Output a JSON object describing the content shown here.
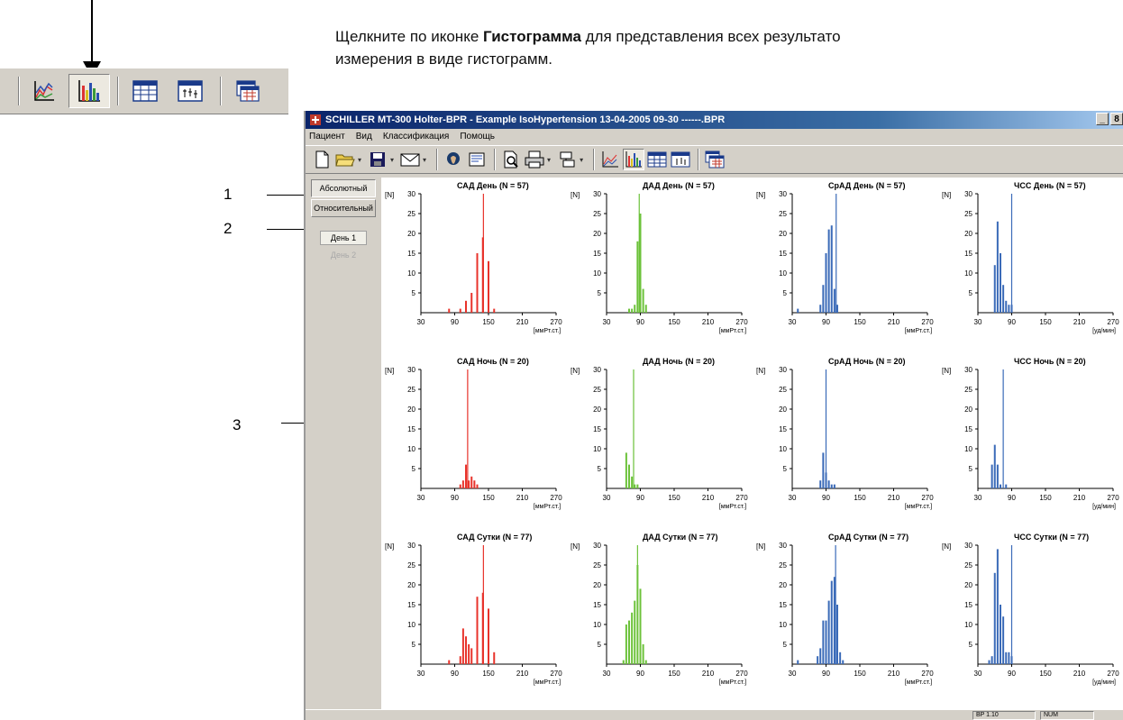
{
  "instruction": {
    "before": "Щелкните по иконке ",
    "bold": "Гистограмма",
    "after": " для представления всех результато",
    "line2": "измерения в виде гистограмм."
  },
  "callouts": [
    "1",
    "2",
    "3"
  ],
  "window": {
    "title": "SCHILLER MT-300 Holter-BPR - Example IsoHypertension 13-04-2005 09-30 ------.BPR",
    "controls": [
      "_",
      "8"
    ]
  },
  "menu": [
    "Пациент",
    "Вид",
    "Классификация",
    "Помощь"
  ],
  "toolbar_icons": [
    "new-file-icon",
    "open-folder-icon",
    "save-icon",
    "mail-icon",
    "patient-icon",
    "report-icon",
    "print-preview-icon",
    "print-icon",
    "device-icon",
    "trend-chart-icon",
    "histogram-icon",
    "table-icon",
    "statistics-table-icon",
    "window-icon"
  ],
  "side_panel": {
    "absolute": "Абсолютный",
    "relative": "Относительный",
    "day1": "День 1",
    "day2": "День 2"
  },
  "status": [
    "BP 1.10",
    "NUM"
  ],
  "colors": {
    "sad": "#e8332b",
    "dad": "#6cc23a",
    "srad": "#3a6ab8",
    "hr": "#3a6ab8"
  },
  "chart_data": [
    {
      "type": "bar",
      "title": "САД День (N = 57)",
      "ylabel": "[N]",
      "xlabel": "[ммРт.ст.]",
      "x_ticks": [
        30,
        90,
        150,
        210,
        270
      ],
      "ylim": [
        0,
        30
      ],
      "y_ticks": [
        5,
        10,
        15,
        20,
        25,
        30
      ],
      "color": "#e8332b",
      "marker": 141,
      "x": [
        80,
        100,
        110,
        120,
        130,
        140,
        150,
        160
      ],
      "values": [
        1,
        1,
        3,
        5,
        15,
        19,
        13,
        1
      ]
    },
    {
      "type": "bar",
      "title": "ДАД День (N = 57)",
      "ylabel": "[N]",
      "xlabel": "[ммРт.ст.]",
      "x_ticks": [
        30,
        90,
        150,
        210,
        270
      ],
      "ylim": [
        0,
        30
      ],
      "y_ticks": [
        5,
        10,
        15,
        20,
        25,
        30
      ],
      "color": "#6cc23a",
      "marker": 88,
      "x": [
        70,
        75,
        80,
        85,
        90,
        95,
        100
      ],
      "values": [
        1,
        1,
        2,
        18,
        25,
        6,
        2
      ]
    },
    {
      "type": "bar",
      "title": "СрАД День (N = 57)",
      "ylabel": "[N]",
      "xlabel": "[ммРт.ст.]",
      "x_ticks": [
        30,
        90,
        150,
        210,
        270
      ],
      "ylim": [
        0,
        30
      ],
      "y_ticks": [
        5,
        10,
        15,
        20,
        25,
        30
      ],
      "color": "#3a6ab8",
      "marker": 108,
      "x": [
        40,
        80,
        85,
        90,
        95,
        100,
        105,
        110
      ],
      "values": [
        1,
        2,
        7,
        15,
        21,
        22,
        6,
        2
      ]
    },
    {
      "type": "bar",
      "title": "ЧСС День (N = 57)",
      "ylabel": "[N]",
      "xlabel": "[уд/мин]",
      "x_ticks": [
        30,
        90,
        150,
        210,
        270
      ],
      "ylim": [
        0,
        30
      ],
      "y_ticks": [
        5,
        10,
        15,
        20,
        25,
        30
      ],
      "color": "#3a6ab8",
      "marker": 90,
      "x": [
        60,
        65,
        70,
        75,
        80,
        85,
        90
      ],
      "values": [
        12,
        23,
        15,
        7,
        3,
        2,
        2
      ]
    },
    {
      "type": "bar",
      "title": "САД Ночь (N = 20)",
      "ylabel": "[N]",
      "xlabel": "[ммРт.ст.]",
      "x_ticks": [
        30,
        90,
        150,
        210,
        270
      ],
      "ylim": [
        0,
        30
      ],
      "y_ticks": [
        5,
        10,
        15,
        20,
        25,
        30
      ],
      "color": "#e8332b",
      "marker": 113,
      "x": [
        100,
        105,
        110,
        115,
        120,
        125,
        130
      ],
      "values": [
        1,
        2,
        6,
        2,
        3,
        2,
        1
      ]
    },
    {
      "type": "bar",
      "title": "ДАД Ночь (N = 20)",
      "ylabel": "[N]",
      "xlabel": "[ммРт.ст.]",
      "x_ticks": [
        30,
        90,
        150,
        210,
        270
      ],
      "ylim": [
        0,
        30
      ],
      "y_ticks": [
        5,
        10,
        15,
        20,
        25,
        30
      ],
      "color": "#6cc23a",
      "marker": 78,
      "x": [
        65,
        70,
        75,
        80,
        85
      ],
      "values": [
        9,
        6,
        3,
        1,
        1
      ]
    },
    {
      "type": "bar",
      "title": "СрАД Ночь (N = 20)",
      "ylabel": "[N]",
      "xlabel": "[ммРт.ст.]",
      "x_ticks": [
        30,
        90,
        150,
        210,
        270
      ],
      "ylim": [
        0,
        30
      ],
      "y_ticks": [
        5,
        10,
        15,
        20,
        25,
        30
      ],
      "color": "#3a6ab8",
      "marker": 90,
      "x": [
        80,
        85,
        90,
        95,
        100,
        105
      ],
      "values": [
        2,
        9,
        4,
        2,
        1,
        1
      ]
    },
    {
      "type": "bar",
      "title": "ЧСС Ночь (N = 20)",
      "ylabel": "[N]",
      "xlabel": "[уд/мин]",
      "x_ticks": [
        30,
        90,
        150,
        210,
        270
      ],
      "ylim": [
        0,
        30
      ],
      "y_ticks": [
        5,
        10,
        15,
        20,
        25,
        30
      ],
      "color": "#3a6ab8",
      "marker": 75,
      "x": [
        55,
        60,
        65,
        70,
        80
      ],
      "values": [
        6,
        11,
        6,
        1,
        1
      ]
    },
    {
      "type": "bar",
      "title": "САД Сутки (N = 77)",
      "ylabel": "[N]",
      "xlabel": "[ммРт.ст.]",
      "x_ticks": [
        30,
        90,
        150,
        210,
        270
      ],
      "ylim": [
        0,
        30
      ],
      "y_ticks": [
        5,
        10,
        15,
        20,
        25,
        30
      ],
      "color": "#e8332b",
      "marker": 141,
      "x": [
        80,
        100,
        105,
        110,
        115,
        120,
        130,
        140,
        150,
        160
      ],
      "values": [
        1,
        2,
        9,
        7,
        5,
        4,
        17,
        18,
        14,
        3
      ]
    },
    {
      "type": "bar",
      "title": "ДАД Сутки (N = 77)",
      "ylabel": "[N]",
      "xlabel": "[ммРт.ст.]",
      "x_ticks": [
        30,
        90,
        150,
        210,
        270
      ],
      "ylim": [
        0,
        30
      ],
      "y_ticks": [
        5,
        10,
        15,
        20,
        25,
        30
      ],
      "color": "#6cc23a",
      "marker": 85,
      "x": [
        60,
        65,
        70,
        75,
        80,
        85,
        90,
        95,
        100
      ],
      "values": [
        1,
        10,
        11,
        13,
        16,
        25,
        19,
        5,
        1
      ]
    },
    {
      "type": "bar",
      "title": "СрАД Сутки (N = 77)",
      "ylabel": "[N]",
      "xlabel": "[ммРт.ст.]",
      "x_ticks": [
        30,
        90,
        150,
        210,
        270
      ],
      "ylim": [
        0,
        30
      ],
      "y_ticks": [
        5,
        10,
        15,
        20,
        25,
        30
      ],
      "color": "#3a6ab8",
      "marker": 107,
      "x": [
        40,
        75,
        80,
        85,
        90,
        95,
        100,
        105,
        110,
        115,
        120
      ],
      "values": [
        1,
        2,
        4,
        11,
        11,
        16,
        21,
        22,
        15,
        3,
        1
      ]
    },
    {
      "type": "bar",
      "title": "ЧСС Сутки (N = 77)",
      "ylabel": "[N]",
      "xlabel": "[уд/мин]",
      "x_ticks": [
        30,
        90,
        150,
        210,
        270
      ],
      "ylim": [
        0,
        30
      ],
      "y_ticks": [
        5,
        10,
        15,
        20,
        25,
        30
      ],
      "color": "#3a6ab8",
      "marker": 90,
      "x": [
        50,
        55,
        60,
        65,
        70,
        75,
        80,
        85,
        90
      ],
      "values": [
        1,
        2,
        23,
        29,
        15,
        12,
        3,
        3,
        2
      ]
    }
  ]
}
